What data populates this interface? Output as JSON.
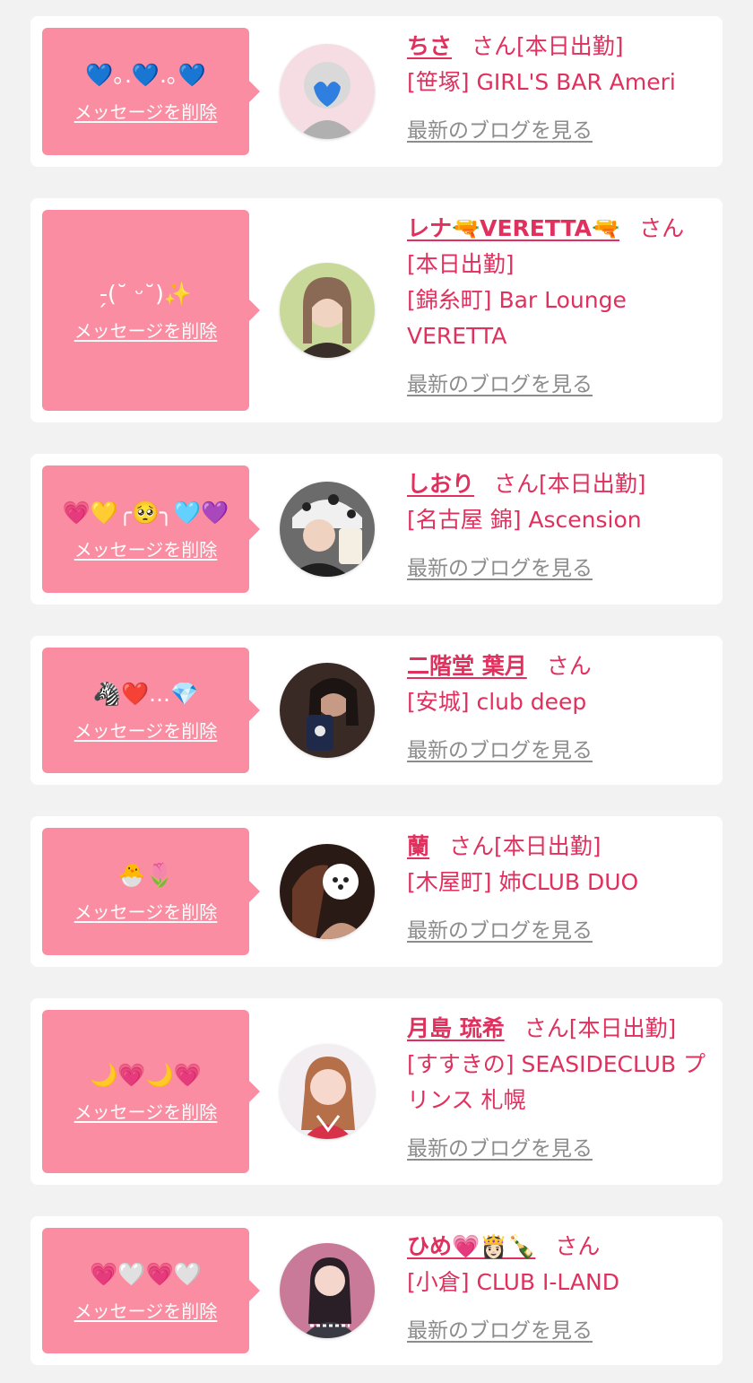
{
  "common": {
    "delete_label": "メッセージを削除",
    "blog_label": "最新のブログを見る",
    "san": "さん"
  },
  "colors": {
    "background": "#f2f2f2",
    "card": "#ffffff",
    "bubble": "#fa8da1",
    "accent": "#e0305e",
    "link_gray": "#8c8c8c"
  },
  "cards": [
    {
      "message": "💙｡.💙.｡💙",
      "name": "ちさ",
      "status": "[本日出勤]",
      "shop": "[笹塚] GIRL'S BAR Ameri"
    },
    {
      "message": "-̗(˘ ᵕ˘)✨",
      "name": "レナ🔫VERETTA🔫",
      "status": "[本日出勤]",
      "shop": "[錦糸町] Bar Lounge VERETTA"
    },
    {
      "message": "💗💛╭🥺╮🩵💜",
      "name": "しおり",
      "status": "[本日出勤]",
      "shop": "[名古屋 錦] Ascension"
    },
    {
      "message": "🦓❤️...💎",
      "name": "二階堂 葉月",
      "status": "",
      "shop": "[安城] club deep"
    },
    {
      "message": "🐣🌷",
      "name": "蘭",
      "status": "[本日出勤]",
      "shop": "[木屋町] 姉CLUB DUO"
    },
    {
      "message": "🌙💗🌙💗",
      "name": "月島 琉希",
      "status": "[本日出勤]",
      "shop": "[すすきの] SEASIDECLUB プリンス 札幌"
    },
    {
      "message": "💗🤍💗🤍",
      "name": "ひめ💗👸🏻🍾",
      "status": "",
      "shop": "[小倉] CLUB I-LAND"
    }
  ]
}
